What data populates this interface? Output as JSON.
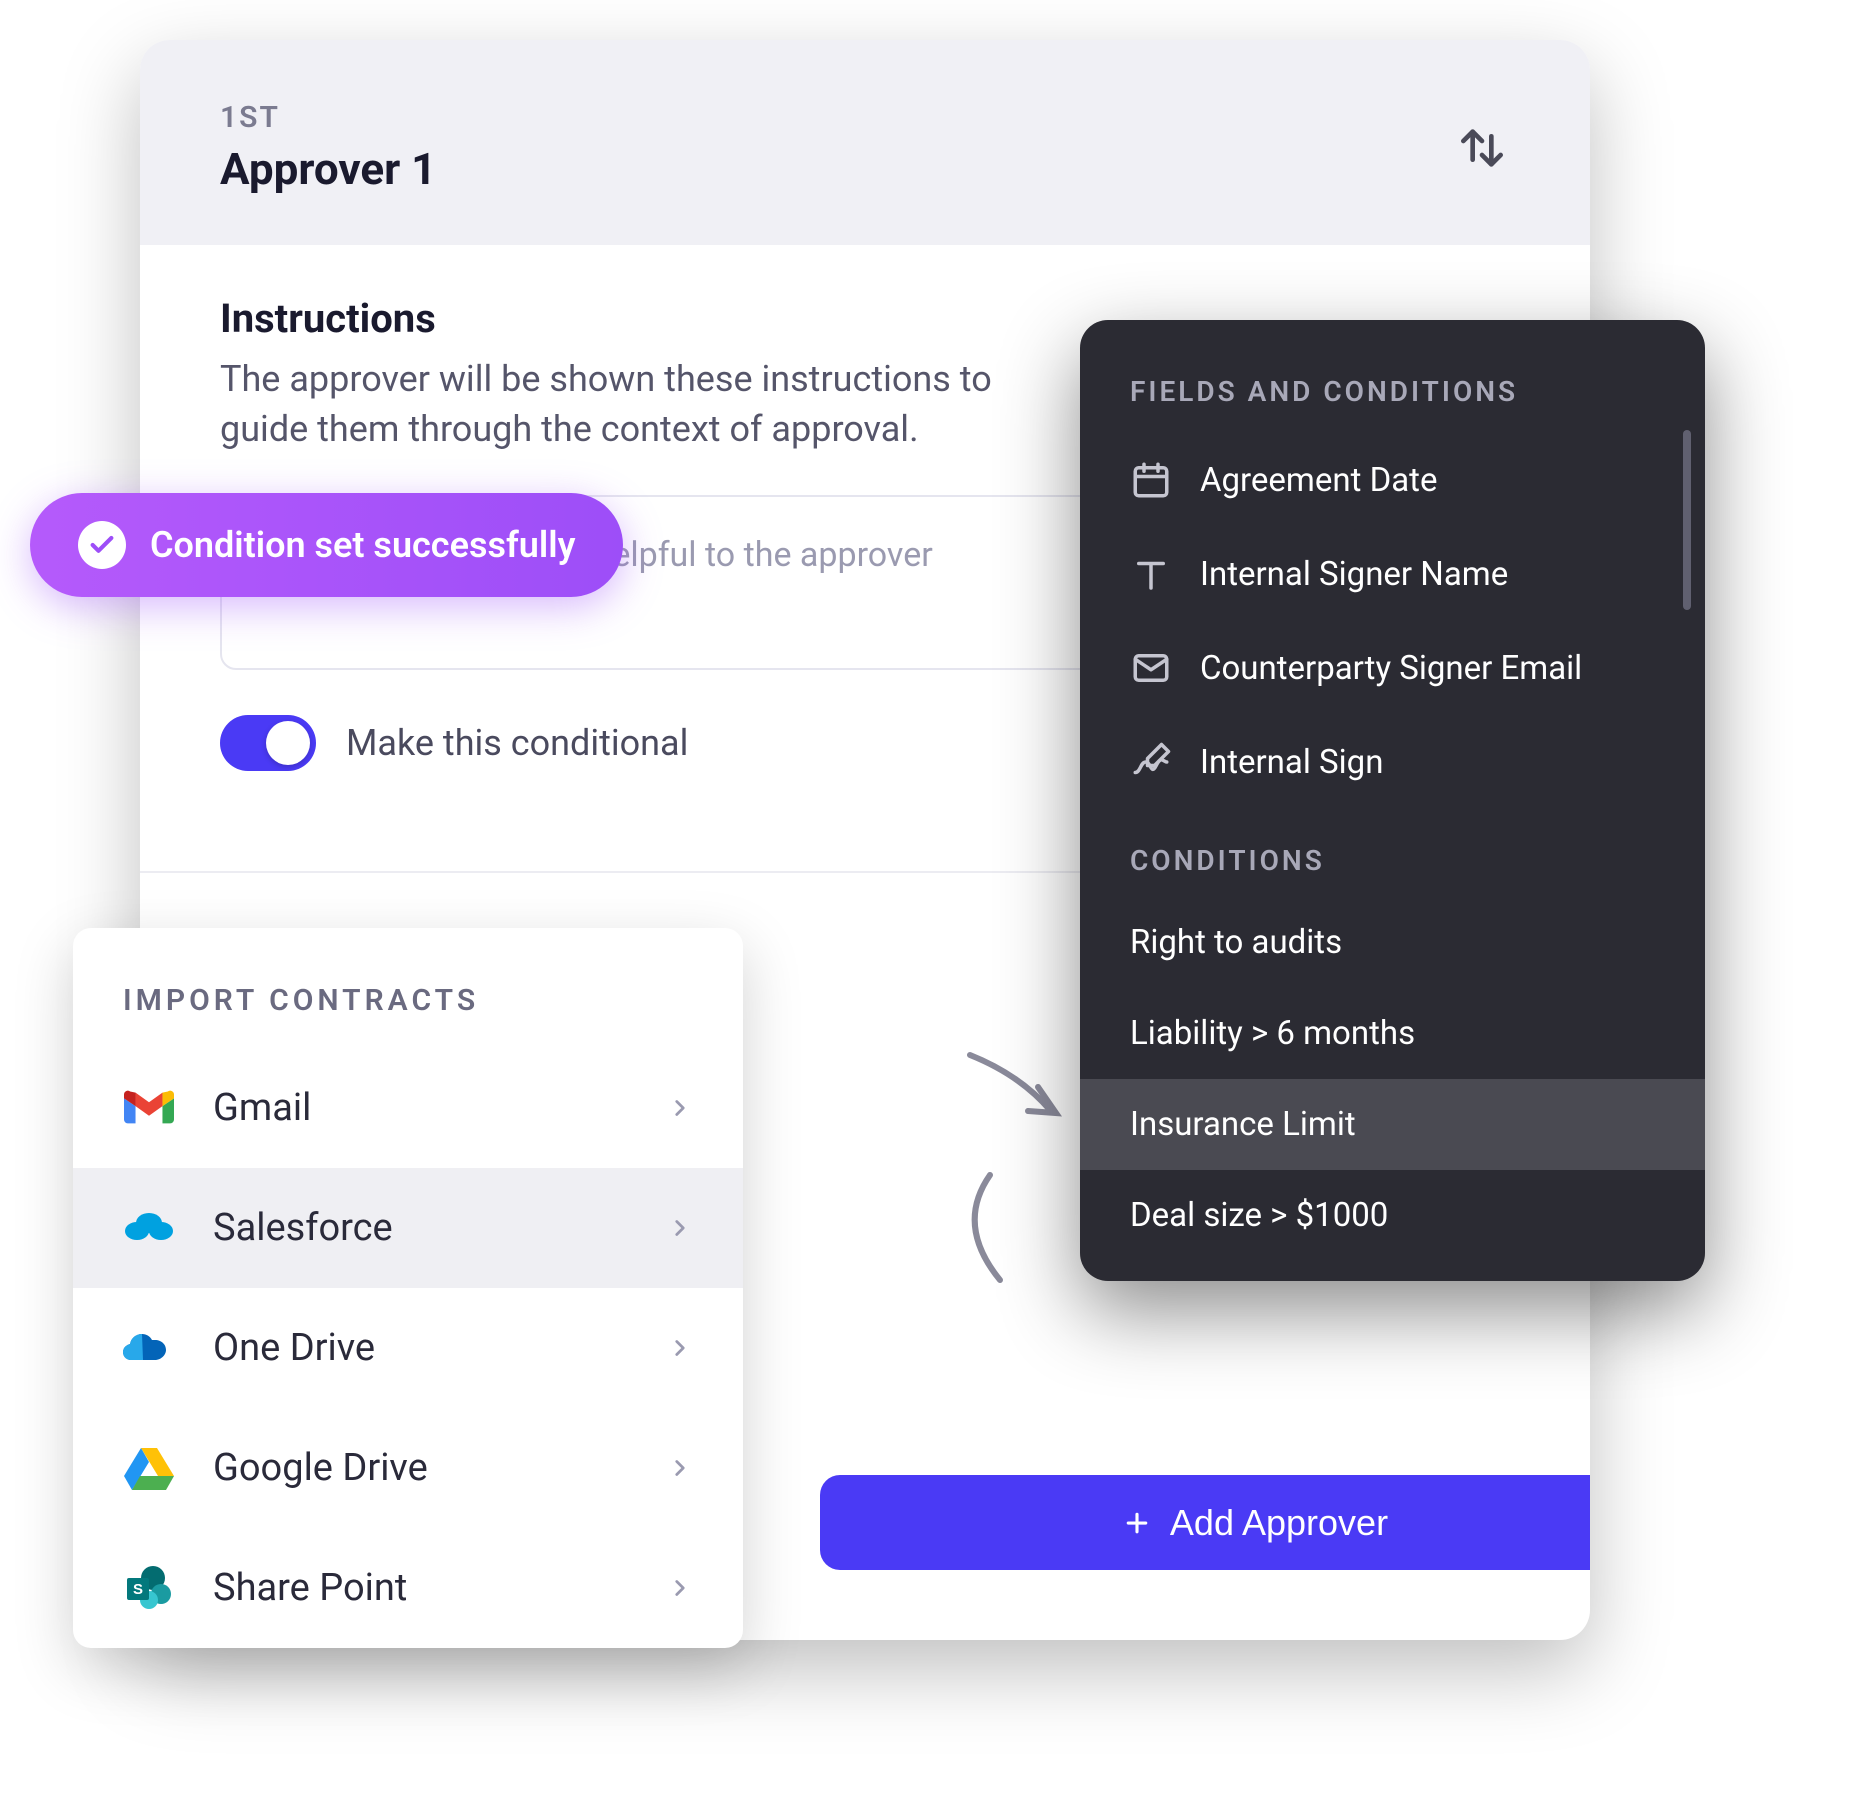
{
  "approver": {
    "ordinal": "1ST",
    "title": "Approver 1",
    "instructions_title": "Instructions",
    "instructions_desc": "The approver will be shown these instructions to guide them through the context of approval.",
    "placeholder": "What context may be helpful to the approver",
    "toggle_label": "Make this conditional",
    "add_button_label": "Add Approver"
  },
  "toast": {
    "message": "Condition set successfully"
  },
  "import": {
    "title": "IMPORT CONTRACTS",
    "items": [
      "Gmail",
      "Salesforce",
      "One Drive",
      "Google Drive",
      "Share Point"
    ]
  },
  "fields_panel": {
    "title": "FIELDS AND CONDITIONS",
    "fields": [
      {
        "icon": "calendar",
        "label": "Agreement Date"
      },
      {
        "icon": "text",
        "label": "Internal Signer Name"
      },
      {
        "icon": "mail",
        "label": "Counterparty Signer Email"
      },
      {
        "icon": "signature",
        "label": "Internal Sign"
      }
    ],
    "conditions_title": "CONDITIONS",
    "conditions": [
      "Right to audits",
      "Liability > 6 months",
      "Insurance Limit",
      "Deal size > $1000"
    ],
    "highlighted_condition_index": 2
  }
}
